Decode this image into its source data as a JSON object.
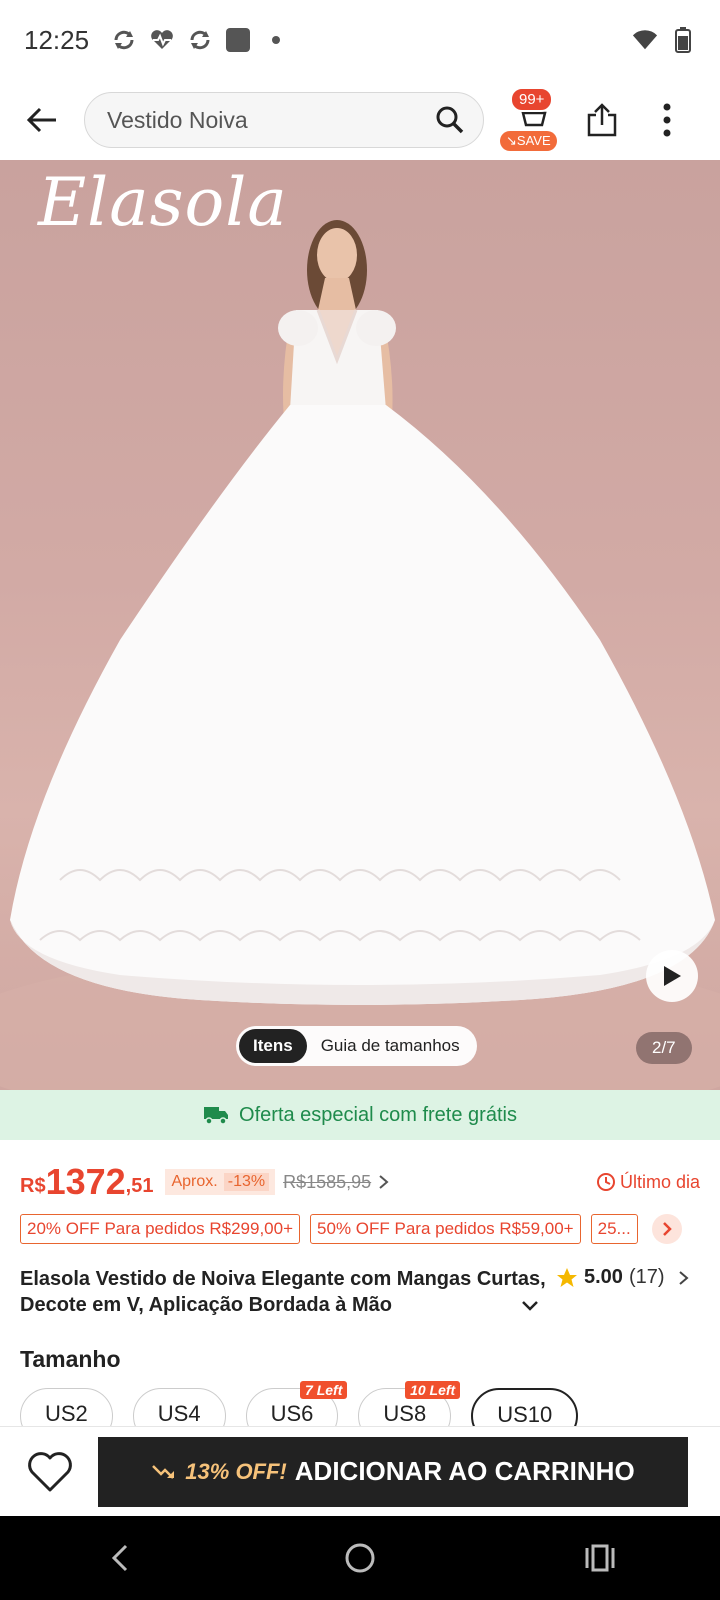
{
  "status_bar": {
    "time": "12:25"
  },
  "header": {
    "search_value": "Vestido Noiva",
    "cart_count": "99+",
    "save_label": "SAVE"
  },
  "gallery": {
    "brand_logo": "Elasola",
    "tabs": [
      "Itens",
      "Guia de tamanhos"
    ],
    "active_tab": "Itens",
    "counter": "2/7"
  },
  "promo": {
    "text": "Oferta especial com frete grátis"
  },
  "price": {
    "currency": "R$",
    "integer": "1372",
    "cents": ",51",
    "aprox_label": "Aprox.",
    "discount": "-13%",
    "old_price": "R$1585,95",
    "deadline": "Último dia"
  },
  "coupons": [
    "20% OFF Para pedidos R$299,00+",
    "50% OFF Para pedidos R$59,00+",
    "25..."
  ],
  "product": {
    "title": "Elasola Vestido de Noiva Elegante com Mangas Curtas, Decote em V, Aplicação Bordada à Mão",
    "rating": "5.00",
    "reviews": "(17)"
  },
  "size": {
    "label": "Tamanho",
    "options": [
      {
        "label": "US2",
        "tag": ""
      },
      {
        "label": "US4",
        "tag": ""
      },
      {
        "label": "US6",
        "tag": "7 Left"
      },
      {
        "label": "US8",
        "tag": "10 Left"
      },
      {
        "label": "US10",
        "tag": ""
      }
    ],
    "selected": "US10"
  },
  "action_bar": {
    "off_label": "13% OFF!",
    "add_label": "ADICIONAR AO CARRINHO"
  },
  "colors": {
    "accent": "#e8452f",
    "promo_green": "#1f8b4c",
    "button_dark": "#222222"
  }
}
